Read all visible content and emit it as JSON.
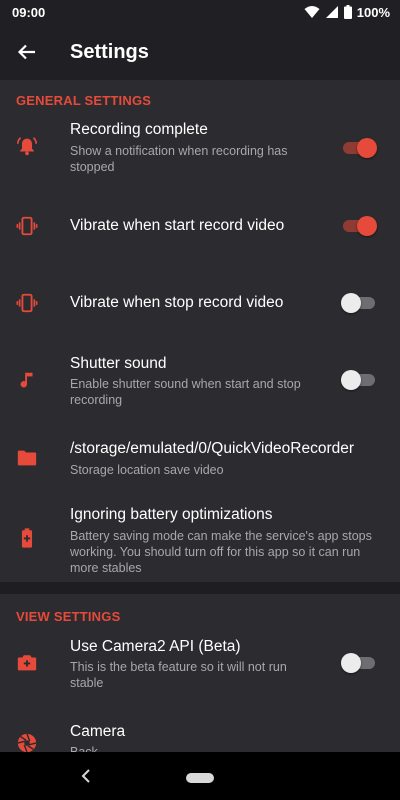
{
  "status_bar": {
    "time": "09:00",
    "battery": "100%"
  },
  "app_bar": {
    "title": "Settings",
    "back_icon": "arrow-left-icon"
  },
  "colors": {
    "accent": "#e64a3a",
    "background": "#2c2c30",
    "bar": "#202024",
    "secondary_text": "#a7a7ac"
  },
  "general": {
    "header": "GENERAL SETTINGS",
    "items": [
      {
        "icon": "alarm-bell-icon",
        "title": "Recording complete",
        "summary": "Show a notification when recording has stopped",
        "toggle": true
      },
      {
        "icon": "vibrate-icon",
        "title": "Vibrate when start record video",
        "summary": "",
        "toggle": true
      },
      {
        "icon": "vibrate-icon",
        "title": "Vibrate when stop record video",
        "summary": "",
        "toggle": false
      },
      {
        "icon": "music-note-icon",
        "title": "Shutter sound",
        "summary": "Enable shutter sound when start and stop recording",
        "toggle": false
      },
      {
        "icon": "folder-icon",
        "title": "/storage/emulated/0/QuickVideoRecorder",
        "summary": "Storage location save video"
      },
      {
        "icon": "battery-charging-icon",
        "title": "Ignoring battery optimizations",
        "summary": "Battery saving mode can make the service's app stops working. You should turn off for this app so it can run more stables"
      }
    ]
  },
  "view": {
    "header": "VIEW SETTINGS",
    "items": [
      {
        "icon": "camera-switch-icon",
        "title": "Use Camera2 API (Beta)",
        "summary": "This is the beta feature so it will not run stable",
        "toggle": false
      },
      {
        "icon": "camera-aperture-icon",
        "title": "Camera",
        "summary": "Back"
      }
    ]
  },
  "nav_bar": {
    "back_icon": "nav-back-icon",
    "home_icon": "nav-home-pill-icon"
  }
}
